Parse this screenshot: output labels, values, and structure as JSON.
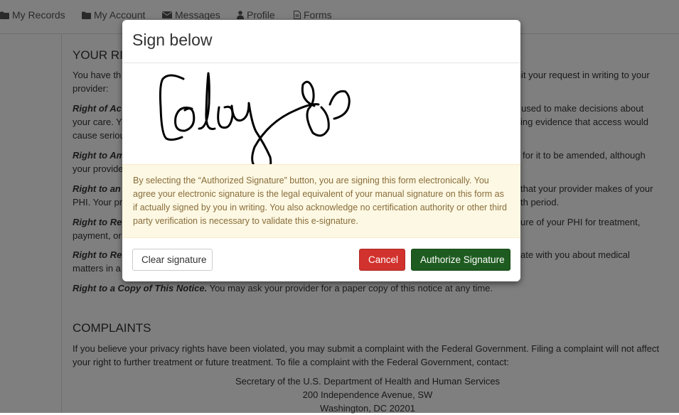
{
  "nav": {
    "items": [
      {
        "label": "My Records",
        "icon": "folder-icon"
      },
      {
        "label": "My Account",
        "icon": "folder-icon"
      },
      {
        "label": "Messages",
        "icon": "envelope-icon"
      },
      {
        "label": "Profile",
        "icon": "user-icon"
      },
      {
        "label": "Forms",
        "icon": "document-icon"
      }
    ]
  },
  "page": {
    "rights_heading": "YOUR RI",
    "intro_left": "You have th",
    "intro_right": "omit your request in writing to your",
    "intro_line2": "provider:",
    "access_title": "Right of Ac",
    "access_right": "be used to make decisions about",
    "access_line2_left": "your care. Y",
    "access_line2_right": "ing evidence that access would",
    "access_line3": "cause seriou",
    "amend_title": "Right to Am",
    "amend_right": "for it to be amended, although",
    "amend_line2": "your provide",
    "acct_title": "Right to an",
    "acct_right": "that your provider makes of your",
    "acct_line2_left": "PHI. Your pr",
    "acct_line2_right": "th period.",
    "restrict_title": "Right to Re",
    "restrict_right": "ure of your PHI for treatment,",
    "restrict_line2": "payment, or",
    "confid_title": "Right to Re",
    "confid_right": "ate with you about medical",
    "confid_line2": "matters in a",
    "copy_title": "Right to a Copy of This Notice.",
    "copy_text": " You may ask your provider for a paper copy of this notice at any time.",
    "complaints_heading": "COMPLAINTS",
    "complaints_text": "If you believe your privacy rights have been violated, you may submit a complaint with the Federal Government. Filing a complaint will not affect your right to further treatment or future treatment. To file a complaint with the Federal Government, contact:",
    "address_line1": "Secretary of the U.S. Department of Health and Human Services",
    "address_line2": "200 Independence Avenue, SW",
    "address_line3": "Washington, DC 20201"
  },
  "modal": {
    "title": "Sign below",
    "notice": "By selecting the “Authorized Signature” button, you are signing this form electronically. You agree your electronic signature is the legal equivalent of your manual signature on this form as if actually signed by you in writing. You also acknowledge no certification authority or other third party verification is necessary to validate this e-signature.",
    "clear_label": "Clear signature",
    "cancel_label": "Cancel",
    "authorize_label": "Authorize Signature"
  },
  "colors": {
    "cancel": "#d2322d",
    "authorize": "#1e5b20",
    "notice_bg": "#fcf8e3",
    "notice_text": "#8a6d3b"
  }
}
